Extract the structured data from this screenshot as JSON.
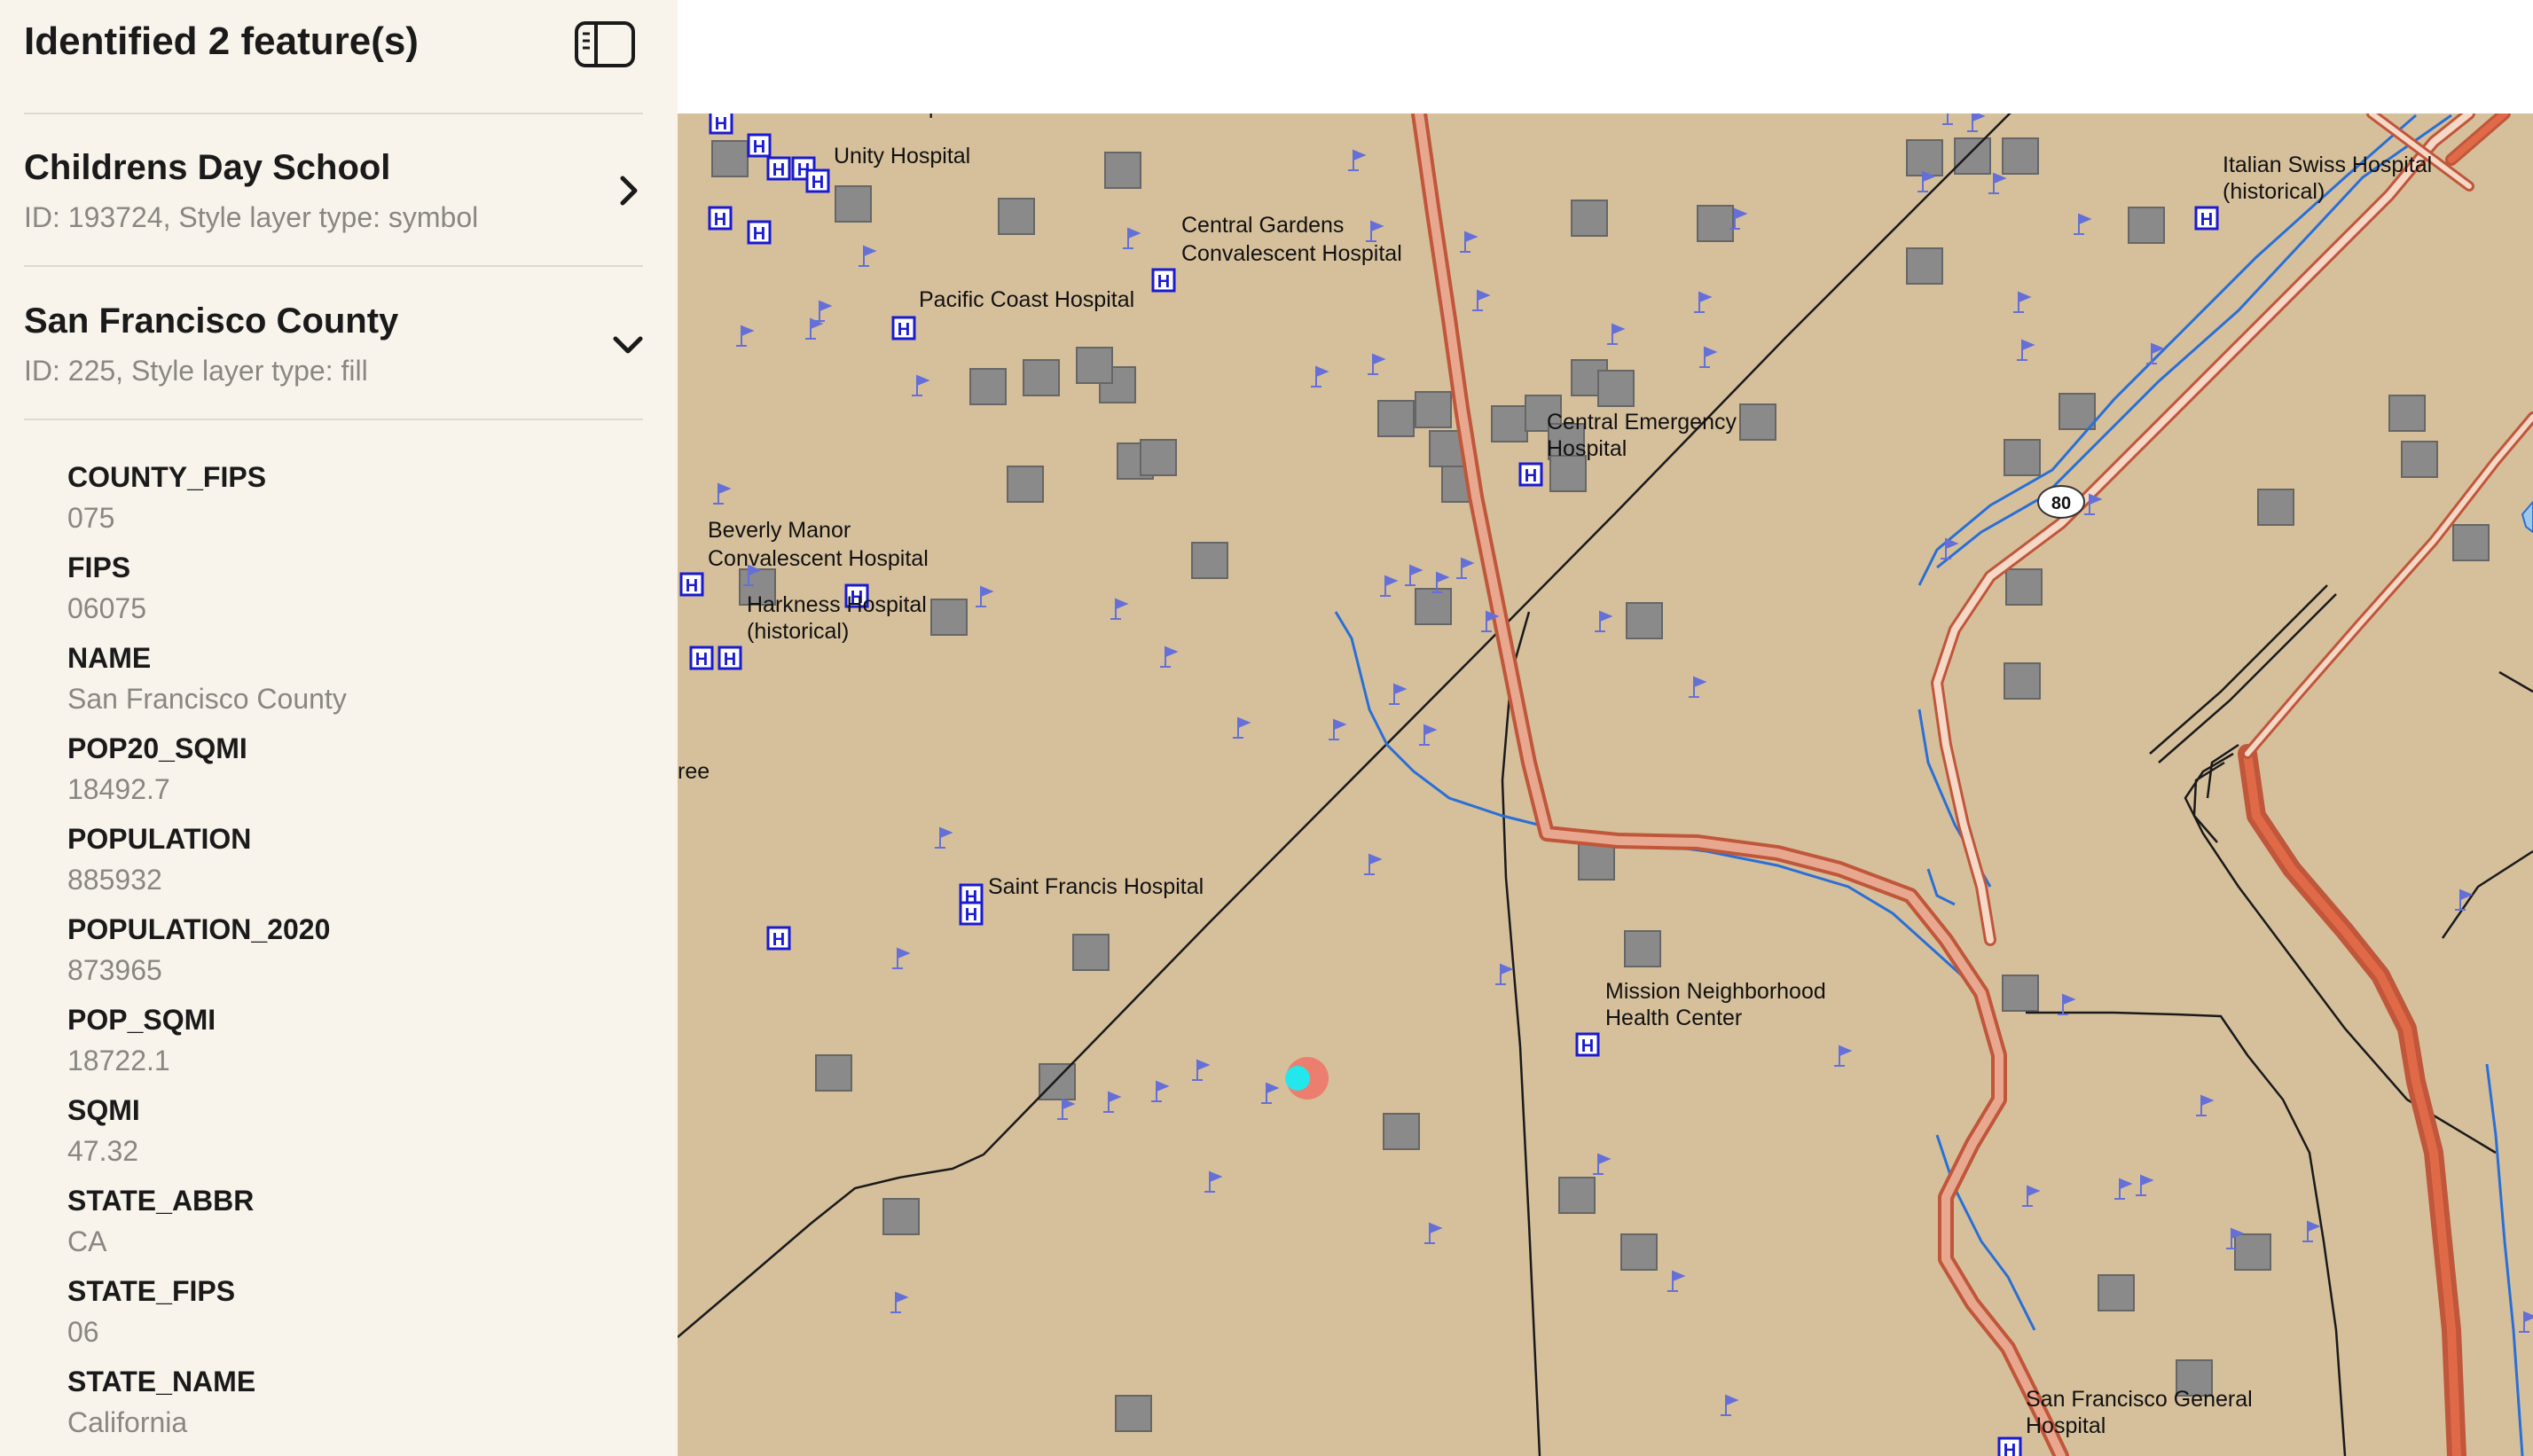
{
  "panel": {
    "title": "Identified 2 feature(s)",
    "toggle_icon": "sidebar-toggle-icon"
  },
  "features": [
    {
      "title": "Childrens Day School",
      "subtitle": "ID: 193724, Style layer type: symbol",
      "chevron": "chevron-right-icon"
    },
    {
      "title": "San Francisco County",
      "subtitle": "ID: 225, Style layer type: fill",
      "chevron": "chevron-down-icon"
    }
  ],
  "attributes": [
    {
      "name": "COUNTY_FIPS",
      "value": "075"
    },
    {
      "name": "FIPS",
      "value": "06075"
    },
    {
      "name": "NAME",
      "value": "San Francisco County"
    },
    {
      "name": "POP20_SQMI",
      "value": "18492.7"
    },
    {
      "name": "POPULATION",
      "value": "885932"
    },
    {
      "name": "POPULATION_2020",
      "value": "873965"
    },
    {
      "name": "POP_SQMI",
      "value": "18722.1"
    },
    {
      "name": "SQMI",
      "value": "47.32"
    },
    {
      "name": "STATE_ABBR",
      "value": "CA"
    },
    {
      "name": "STATE_FIPS",
      "value": "06"
    },
    {
      "name": "STATE_NAME",
      "value": "California"
    }
  ],
  "map": {
    "colors": {
      "land": "#d6c09c",
      "road_fill": "#e8a890",
      "road_edge": "#c0563a",
      "water": "#2a6fd6",
      "building": "#8a8a8a",
      "hospital": "#1a1ad0",
      "flag": "#6470d8",
      "rail": "#1a1a1a"
    },
    "labels": [
      "Convalescent Hospital",
      "Unity Hospital",
      "Central Gardens",
      "Convalescent Hospital",
      "Pacific Coast Hospital",
      "Central Emergency",
      "Hospital",
      "Beverly Manor",
      "Convalescent Hospital",
      "Harkness Hospital",
      "(historical)",
      "Italian Swiss Hospital",
      "(historical)",
      "ree",
      "Saint Francis Hospital",
      "Mission Neighborhood",
      "Health Center",
      "San Francisco General",
      "Hospital"
    ],
    "shield": "80"
  }
}
